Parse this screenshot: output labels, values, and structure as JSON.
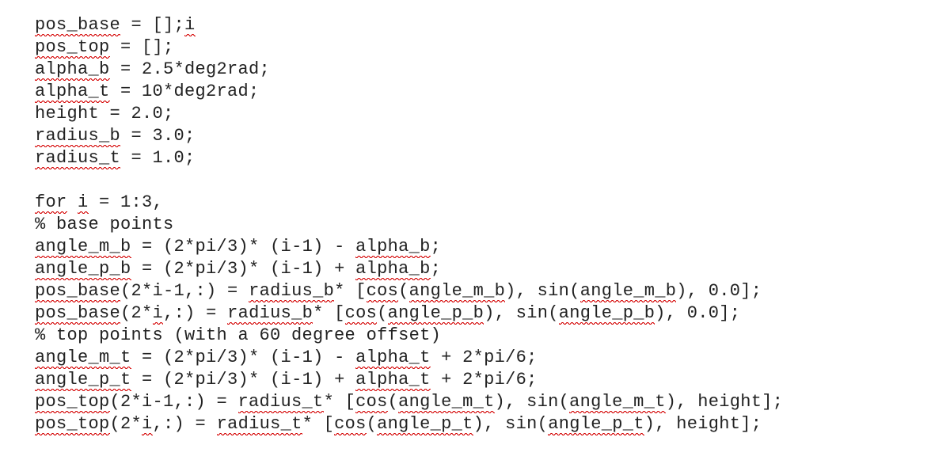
{
  "code": {
    "l01a": "pos_base",
    "l01b": " = [];",
    "l01c": "i",
    "l02a": "pos_top",
    "l02b": " = [];",
    "l03a": "alpha_b",
    "l03b": " = 2.5*deg2rad;",
    "l04a": "alpha_t",
    "l04b": " = 10*deg2rad;",
    "l05": "height = 2.0;",
    "l06a": "radius_b",
    "l06b": " = 3.0;",
    "l07a": "radius_t",
    "l07b": " = 1.0;",
    "l08": "",
    "l09a": "for",
    "l09b": " ",
    "l09c": "i",
    "l09d": " = 1:3,",
    "l10": "% base points",
    "l11a": "angle_m_b",
    "l11b": " = (2*pi/3)* (i-1) - ",
    "l11c": "alpha_b",
    "l11d": ";",
    "l12a": "angle_p_b",
    "l12b": " = (2*pi/3)* (i-1) + ",
    "l12c": "alpha_b",
    "l12d": ";",
    "l13a": "pos_base",
    "l13b": "(2*i-1,:) = ",
    "l13c": "radius_b",
    "l13d": "* [",
    "l13e": "cos",
    "l13f": "(",
    "l13g": "angle_m_b",
    "l13h": "), sin(",
    "l13i": "angle_m_b",
    "l13j": "), 0.0];",
    "l14a": "pos_base",
    "l14b": "(2*",
    "l14c": "i",
    "l14d": ",:) = ",
    "l14e": "radius_b",
    "l14f": "* [",
    "l14g": "cos",
    "l14h": "(",
    "l14i": "angle_p_b",
    "l14j": "), sin(",
    "l14k": "angle_p_b",
    "l14l": "), 0.0];",
    "l15": "% top points (with a 60 degree offset)",
    "l16a": "angle_m_t",
    "l16b": " = (2*pi/3)* (i-1) - ",
    "l16c": "alpha_t",
    "l16d": " + 2*pi/6;",
    "l17a": "angle_p_t",
    "l17b": " = (2*pi/3)* (i-1) + ",
    "l17c": "alpha_t",
    "l17d": " + 2*pi/6;",
    "l18a": "pos_top",
    "l18b": "(2*i-1,:) = ",
    "l18c": "radius_t",
    "l18d": "* [",
    "l18e": "cos",
    "l18f": "(",
    "l18g": "angle_m_t",
    "l18h": "), sin(",
    "l18i": "angle_m_t",
    "l18j": "), height];",
    "l19a": "pos_top",
    "l19b": "(2*",
    "l19c": "i",
    "l19d": ",:) = ",
    "l19e": "radius_t",
    "l19f": "* [",
    "l19g": "cos",
    "l19h": "(",
    "l19i": "angle_p_t",
    "l19j": "), sin(",
    "l19k": "angle_p_t",
    "l19l": "), height];"
  }
}
